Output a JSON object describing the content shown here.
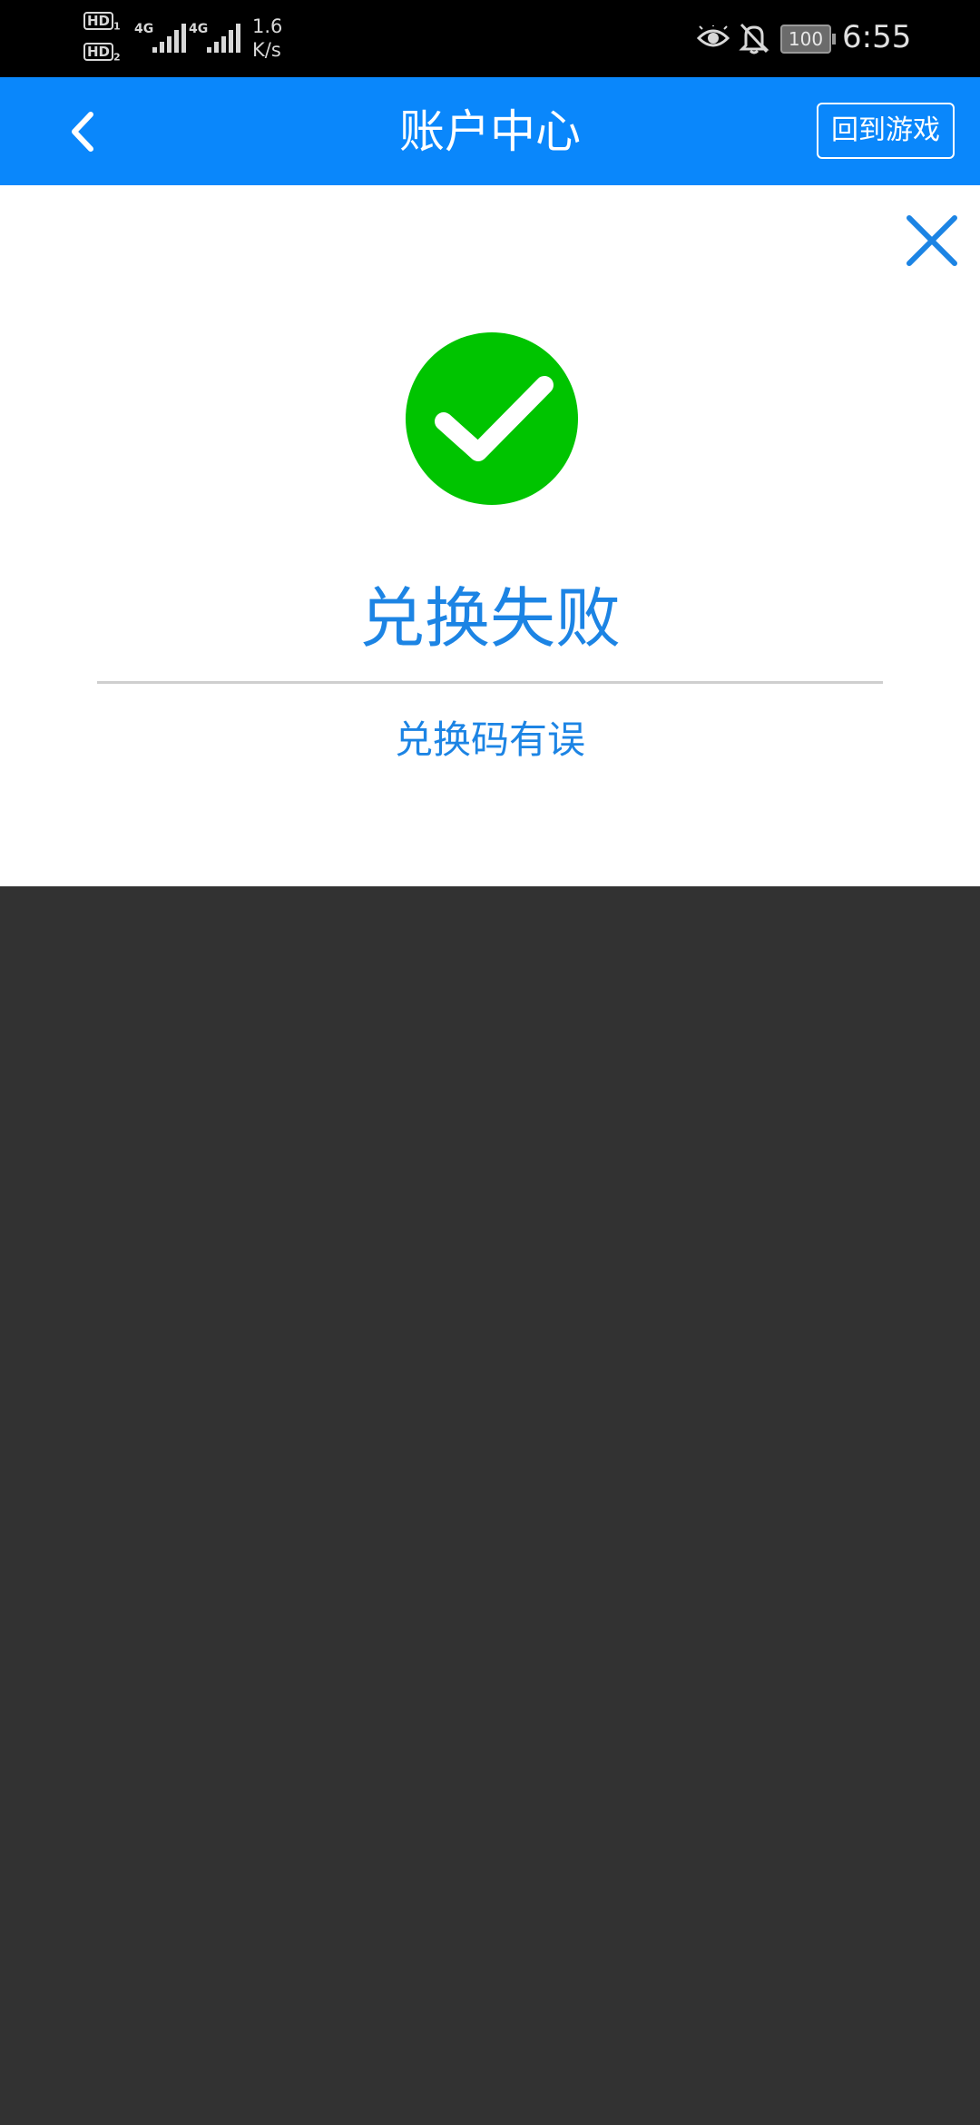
{
  "status_bar": {
    "sim1_label": "HD",
    "sim1_index": "1",
    "sim2_label": "HD",
    "sim2_index": "2",
    "network1": "4G",
    "network2": "4G",
    "speed_value": "1.6",
    "speed_unit": "K/s",
    "battery": "100",
    "time": "6:55",
    "icons": [
      "eye-comfort-icon",
      "bell-muted-icon",
      "battery-icon"
    ]
  },
  "app_bar": {
    "title": "账户中心",
    "return_label": "回到游戏",
    "background_color": "#0a87fb",
    "back_icon": "chevron-left-icon"
  },
  "result": {
    "icon": "check-circle-icon",
    "icon_color": "#00c400",
    "title": "兑换失败",
    "message": "兑换码有误",
    "text_color": "#1c84e4",
    "close_icon": "close-icon"
  }
}
